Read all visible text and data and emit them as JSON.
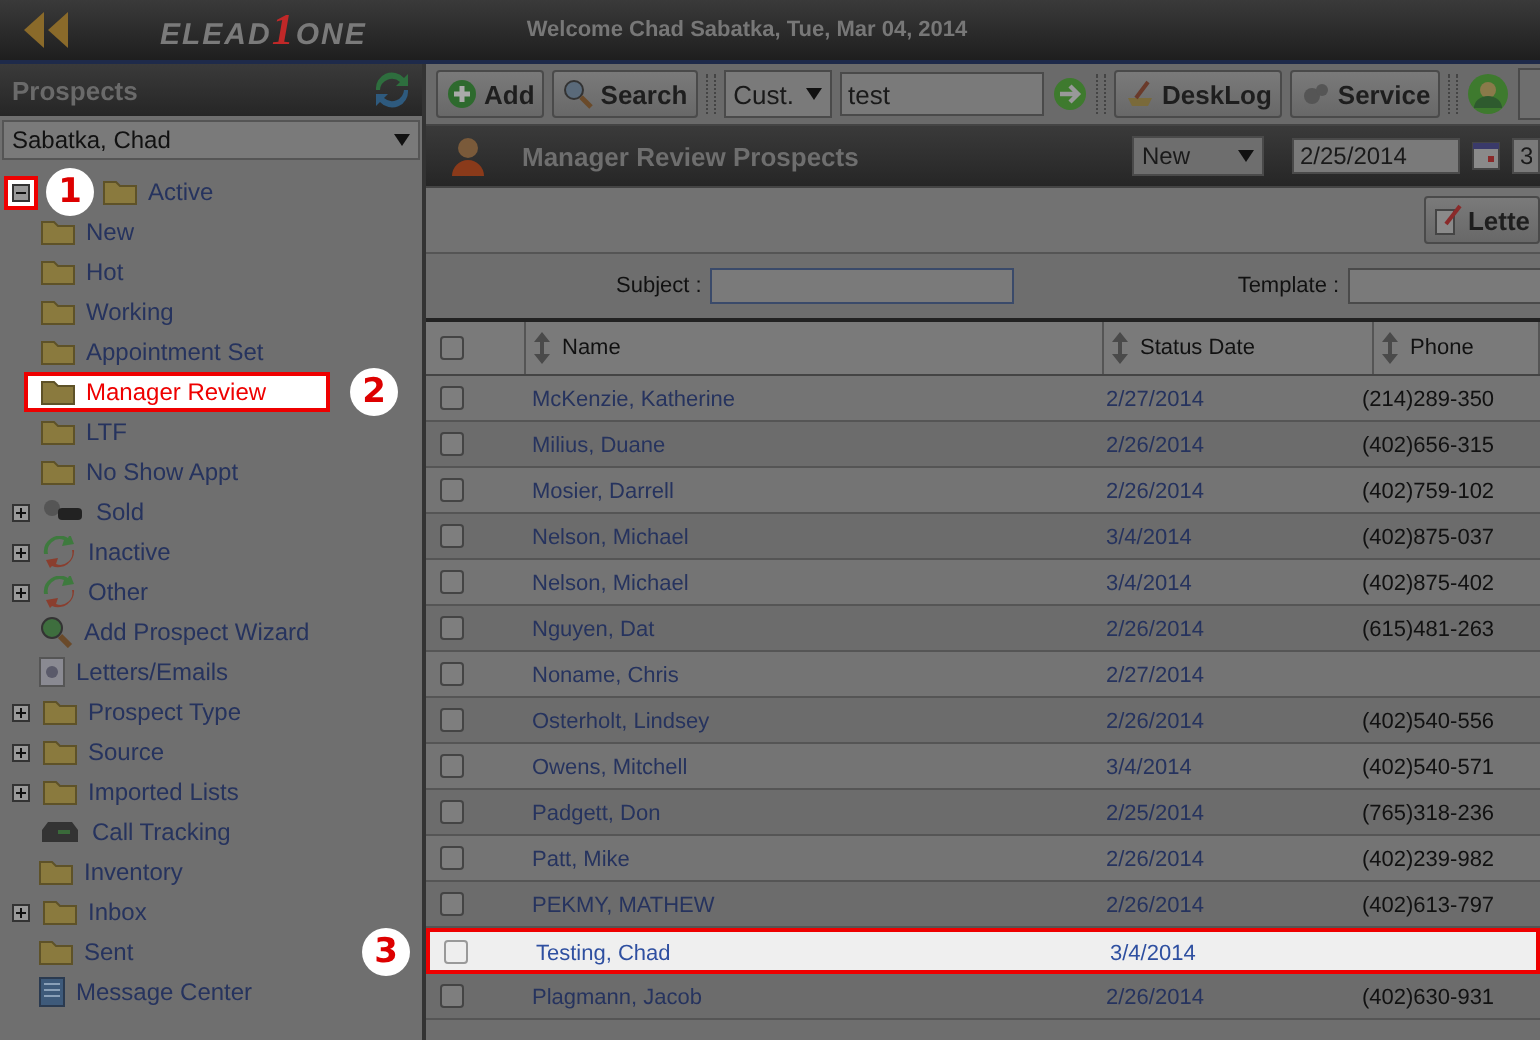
{
  "header": {
    "logo": {
      "left": "ELEAD",
      "digit": "1",
      "right": "ONE"
    },
    "welcome": "Welcome Chad Sabatka, Tue, Mar 04, 2014"
  },
  "sidebar": {
    "title": "Prospects",
    "user_select": "Sabatka, Chad",
    "tree": [
      {
        "label": "Active",
        "kind": "folder",
        "expanded": true,
        "highlighted": true,
        "callout": "1",
        "children": [
          {
            "label": "New",
            "kind": "folder"
          },
          {
            "label": "Hot",
            "kind": "folder"
          },
          {
            "label": "Working",
            "kind": "folder"
          },
          {
            "label": "Appointment Set",
            "kind": "folder"
          },
          {
            "label": "Manager Review",
            "kind": "folder",
            "highlighted": true,
            "callout": "2"
          },
          {
            "label": "LTF",
            "kind": "folder"
          },
          {
            "label": "No Show Appt",
            "kind": "folder"
          }
        ]
      },
      {
        "label": "Sold",
        "kind": "key",
        "expanded": false
      },
      {
        "label": "Inactive",
        "kind": "recycle",
        "expanded": false
      },
      {
        "label": "Other",
        "kind": "recycle",
        "expanded": false
      },
      {
        "label": "Add Prospect Wizard",
        "kind": "wizard"
      },
      {
        "label": "Letters/Emails",
        "kind": "letter"
      },
      {
        "label": "Prospect Type",
        "kind": "folder",
        "expanded": false
      },
      {
        "label": "Source",
        "kind": "folder",
        "expanded": false
      },
      {
        "label": "Imported Lists",
        "kind": "folder",
        "expanded": false
      },
      {
        "label": "Call Tracking",
        "kind": "phone"
      },
      {
        "label": "Inventory",
        "kind": "folder"
      },
      {
        "label": "Inbox",
        "kind": "folder",
        "expanded": false
      },
      {
        "label": "Sent",
        "kind": "folder"
      },
      {
        "label": "Message Center",
        "kind": "message"
      }
    ]
  },
  "toolbar": {
    "add": "Add",
    "search": "Search",
    "search_type": "Cust.",
    "search_value": "test",
    "desklog": "DeskLog",
    "service": "Service"
  },
  "view": {
    "title": "Manager Review Prospects",
    "status_select": "New",
    "from_date": "2/25/2014",
    "to_date": "3",
    "letter_button": "Lette",
    "subject_label": "Subject :",
    "template_label": "Template :"
  },
  "table": {
    "header_checked": false,
    "columns": [
      "Name",
      "Status Date",
      "Phone"
    ],
    "rows": [
      {
        "checked": false,
        "highlighted": false,
        "name": "McKenzie, Katherine",
        "status_date": "2/27/2014",
        "phone": "(214)289-350"
      },
      {
        "checked": false,
        "highlighted": false,
        "name": "Milius, Duane",
        "status_date": "2/26/2014",
        "phone": "(402)656-315"
      },
      {
        "checked": false,
        "highlighted": false,
        "name": "Mosier, Darrell",
        "status_date": "2/26/2014",
        "phone": "(402)759-102"
      },
      {
        "checked": false,
        "highlighted": false,
        "name": "Nelson, Michael",
        "status_date": "3/4/2014",
        "phone": "(402)875-037"
      },
      {
        "checked": false,
        "highlighted": false,
        "name": "Nelson, Michael",
        "status_date": "3/4/2014",
        "phone": "(402)875-402"
      },
      {
        "checked": false,
        "highlighted": false,
        "name": "Nguyen, Dat",
        "status_date": "2/26/2014",
        "phone": "(615)481-263"
      },
      {
        "checked": false,
        "highlighted": false,
        "name": "Noname, Chris",
        "status_date": "2/27/2014",
        "phone": ""
      },
      {
        "checked": false,
        "highlighted": false,
        "name": "Osterholt, Lindsey",
        "status_date": "2/26/2014",
        "phone": "(402)540-556"
      },
      {
        "checked": false,
        "highlighted": false,
        "name": "Owens, Mitchell",
        "status_date": "3/4/2014",
        "phone": "(402)540-571"
      },
      {
        "checked": false,
        "highlighted": false,
        "name": "Padgett, Don",
        "status_date": "2/25/2014",
        "phone": "(765)318-236"
      },
      {
        "checked": false,
        "highlighted": false,
        "name": "Patt, Mike",
        "status_date": "2/26/2014",
        "phone": "(402)239-982"
      },
      {
        "checked": false,
        "highlighted": false,
        "name": "PEKMY, MATHEW",
        "status_date": "2/26/2014",
        "phone": "(402)613-797"
      },
      {
        "checked": false,
        "highlighted": true,
        "callout": "3",
        "name": "Testing, Chad",
        "status_date": "3/4/2014",
        "phone": ""
      },
      {
        "checked": false,
        "highlighted": false,
        "name": "Plagmann, Jacob",
        "status_date": "2/26/2014",
        "phone": "(402)630-931"
      }
    ]
  }
}
